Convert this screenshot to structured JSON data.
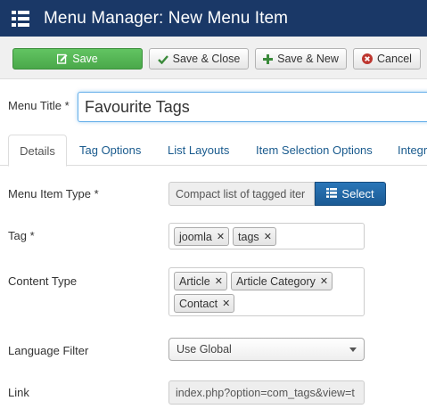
{
  "header": {
    "title": "Menu Manager: New Menu Item",
    "menu_icon": "list-icon"
  },
  "toolbar": {
    "save_label": "Save",
    "save_close_label": "Save & Close",
    "save_new_label": "Save & New",
    "cancel_label": "Cancel",
    "colors": {
      "save_bg": "#5bb75b",
      "header_bg": "#1a3867",
      "select_bg": "#2270b0"
    }
  },
  "form": {
    "menu_title_label": "Menu Title *",
    "menu_title_value": "Favourite Tags"
  },
  "tabs": [
    {
      "label": "Details",
      "active": true
    },
    {
      "label": "Tag Options"
    },
    {
      "label": "List Layouts"
    },
    {
      "label": "Item Selection Options"
    },
    {
      "label": "Integr"
    }
  ],
  "details": {
    "menu_item_type_label": "Menu Item Type *",
    "menu_item_type_value": "Compact list of tagged iter",
    "select_button_label": "Select",
    "tag_label": "Tag *",
    "tags": [
      "joomla",
      "tags"
    ],
    "content_type_label": "Content Type",
    "content_types": [
      "Article",
      "Article Category",
      "Contact"
    ],
    "language_filter_label": "Language Filter",
    "language_filter_value": "Use Global",
    "link_label": "Link",
    "link_value": "index.php?option=com_tags&view=t"
  }
}
